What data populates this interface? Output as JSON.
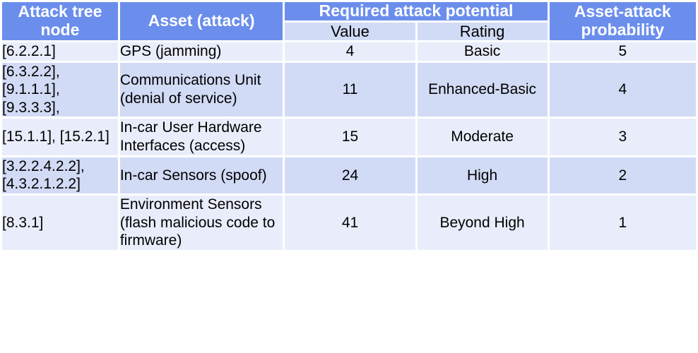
{
  "table": {
    "headers": {
      "attack_tree_node": "Attack tree node",
      "asset_attack": "Asset (attack)",
      "required_attack_potential": "Required attack potential",
      "value": "Value",
      "rating": "Rating",
      "asset_attack_probability": "Asset-attack probability"
    },
    "rows": [
      {
        "node": "[6.2.2.1]",
        "asset": "GPS (jamming)",
        "value": "4",
        "rating": "Basic",
        "probability": "5"
      },
      {
        "node": "[6.3.2.2], [9.1.1.1], [9.3.3.3],",
        "asset": "Communications Unit (denial of service)",
        "value": "11",
        "rating": "Enhanced-Basic",
        "probability": "4"
      },
      {
        "node": "[15.1.1], [15.2.1]",
        "asset": "In-car User Hardware Interfaces (access)",
        "value": "15",
        "rating": "Moderate",
        "probability": "3"
      },
      {
        "node": "[3.2.2.4.2.2], [4.3.2.1.2.2]",
        "asset": "In-car Sensors (spoof)",
        "value": "24",
        "rating": "High",
        "probability": "2"
      },
      {
        "node": "[8.3.1]",
        "asset": "Environment Sensors (flash malicious code to firmware)",
        "value": "41",
        "rating": "Beyond High",
        "probability": "1"
      }
    ]
  },
  "colors": {
    "header_blue": "#6b8eec",
    "row_light": "#e9edfb",
    "row_dark": "#d2dbf5",
    "header_text": "#ffffff",
    "body_text": "#000000",
    "grid_gap": "#ffffff"
  }
}
